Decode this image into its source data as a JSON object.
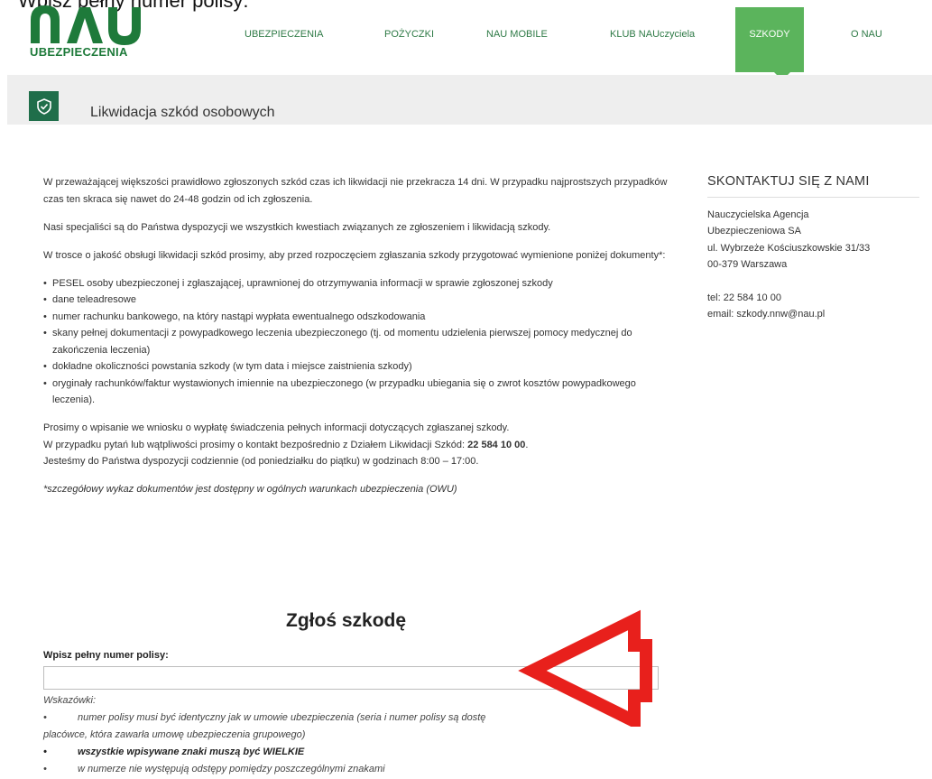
{
  "caption": "Wpisz pełny numer polisy:",
  "logo": {
    "text": "UBEZPIECZENIA",
    "color": "#1e7a3a",
    "mark": "NAU"
  },
  "nav": {
    "items": [
      {
        "label": "UBEZPIECZENIA"
      },
      {
        "label": "POŻYCZKI"
      },
      {
        "label": "NAU MOBILE"
      },
      {
        "label": "KLUB NAUczyciela"
      },
      {
        "label": "SZKODY",
        "active": true
      },
      {
        "label": "O NAU"
      }
    ],
    "active_color": "#5bb45c"
  },
  "banner": {
    "title": "Likwidacja szkód osobowych",
    "icon": "shield-check-icon"
  },
  "content": {
    "p1": "W przeważającej większości prawidłowo zgłoszonych szkód czas ich likwidacji nie przekracza 14 dni.  W przypadku najprostszych przypadków czas ten skraca się nawet do 24-48 godzin od ich zgłoszenia.",
    "p2": "Nasi specjaliści są do Państwa dyspozycji we wszystkich kwestiach związanych ze zgłoszeniem i likwidacją szkody.",
    "p3": "W trosce o jakość obsługi likwidacji szkód prosimy, aby przed rozpoczęciem zgłaszania szkody przygotować wymienione poniżej dokumenty*:",
    "list": [
      "PESEL osoby ubezpieczonej i zgłaszającej, uprawnionej do otrzymywania informacji w sprawie zgłoszonej szkody",
      "dane teleadresowe",
      "numer rachunku bankowego, na który nastąpi wypłata ewentualnego odszkodowania",
      "skany pełnej dokumentacji z powypadkowego leczenia ubezpieczonego (tj. od momentu udzielenia pierwszej pomocy medycznej do zakończenia leczenia)",
      "dokładne okoliczności powstania szkody (w tym data i miejsce zaistnienia szkody)",
      "oryginały rachunków/faktur wystawionych imiennie na ubezpieczonego (w przypadku ubiegania się o zwrot kosztów powypadkowego leczenia)."
    ],
    "p4a": "Prosimy o wpisanie we wniosku o wypłatę świadczenia pełnych informacji dotyczących zgłaszanej szkody.",
    "p4b_pre": "W przypadku pytań lub wątpliwości prosimy o kontakt bezpośrednio z Działem Likwidacji Szkód: ",
    "p4b_phone": "22 584 10 00",
    "p4b_post": ".",
    "p4c": "Jesteśmy do Państwa dyspozycji codziennie (od poniedziałku do piątku) w godzinach 8:00 – 17:00.",
    "note": "*szczegółowy wykaz dokumentów jest dostępny w ogólnych warunkach ubezpieczenia (OWU)"
  },
  "sidebar": {
    "heading": "SKONTAKTUJ SIĘ Z NAMI",
    "line1": "Nauczycielska Agencja",
    "line2": "Ubezpieczeniowa SA",
    "line3": "ul. Wybrzeże Kościuszkowskie 31/33",
    "line4": "00-379 Warszawa",
    "tel": "tel: 22 584 10 00",
    "email": "email: szkody.nnw@nau.pl"
  },
  "form": {
    "title": "Zgłoś szkodę",
    "label": "Wpisz pełny numer polisy:",
    "value": "",
    "placeholder": "",
    "hints_title": "Wskazówki:",
    "hint1": "numer polisy musi być identyczny jak w umowie ubezpieczenia (seria i numer polisy są dostę",
    "hint1b": "placówce, która zawarła umowę ubezpieczenia grupowego)",
    "hint2": "wszystkie wpisywane znaki muszą być WIELKIE",
    "hint3": "w numerze nie występują odstępy pomiędzy poszczególnymi znakami"
  },
  "annotation": {
    "arrow_color": "#e8201c"
  }
}
